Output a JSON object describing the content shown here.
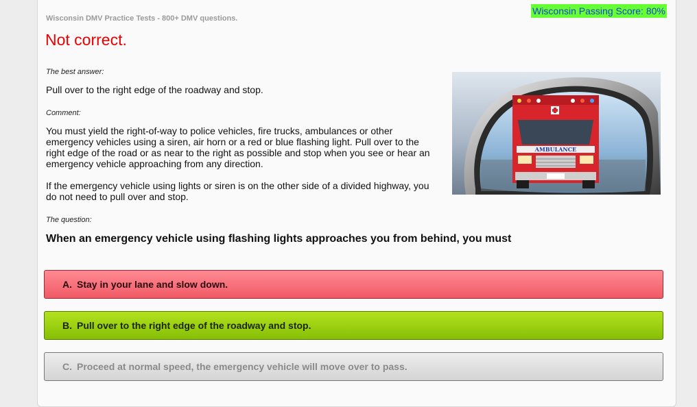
{
  "header": {
    "breadcrumb": "Wisconsin DMV Practice Tests - 800+ DMV questions.",
    "passing_score": "Wisconsin Passing Score: 80%"
  },
  "result": {
    "status": "Not correct."
  },
  "best_answer": {
    "label": "The best answer:",
    "text": "Pull over to the right edge of the roadway and stop."
  },
  "comment": {
    "label": "Comment:",
    "paragraph1": "You must yield the right-of-way to police vehicles, fire trucks, ambulances or other emergency vehicles using a siren, air horn or a red or blue flashing light. Pull over to the right edge of the road or as near to the right as possible and stop when you see or hear an emergency vehicle approaching from any direction.",
    "paragraph2": "If the emergency vehicle using lights or siren is on the other side of a divided highway, you do not need to pull over and stop."
  },
  "question": {
    "label": "The question:",
    "text": "When an emergency vehicle using flashing lights approaches you from behind, you must"
  },
  "image": {
    "vehicle_label": "AMBULANCE"
  },
  "answers": [
    {
      "letter": "A.",
      "text": "Stay in your lane and slow down.",
      "state": "wrong"
    },
    {
      "letter": "B.",
      "text": "Pull over to the right edge of the roadway and stop.",
      "state": "correct"
    },
    {
      "letter": "C.",
      "text": "Proceed at normal speed, the emergency vehicle will move over to pass.",
      "state": "neutral"
    }
  ],
  "colors": {
    "wrong": "#f05a66",
    "correct": "#86bf06",
    "neutral": "#d4d4d4",
    "status_red": "#ee0000",
    "passing_bg": "#66ff33"
  }
}
